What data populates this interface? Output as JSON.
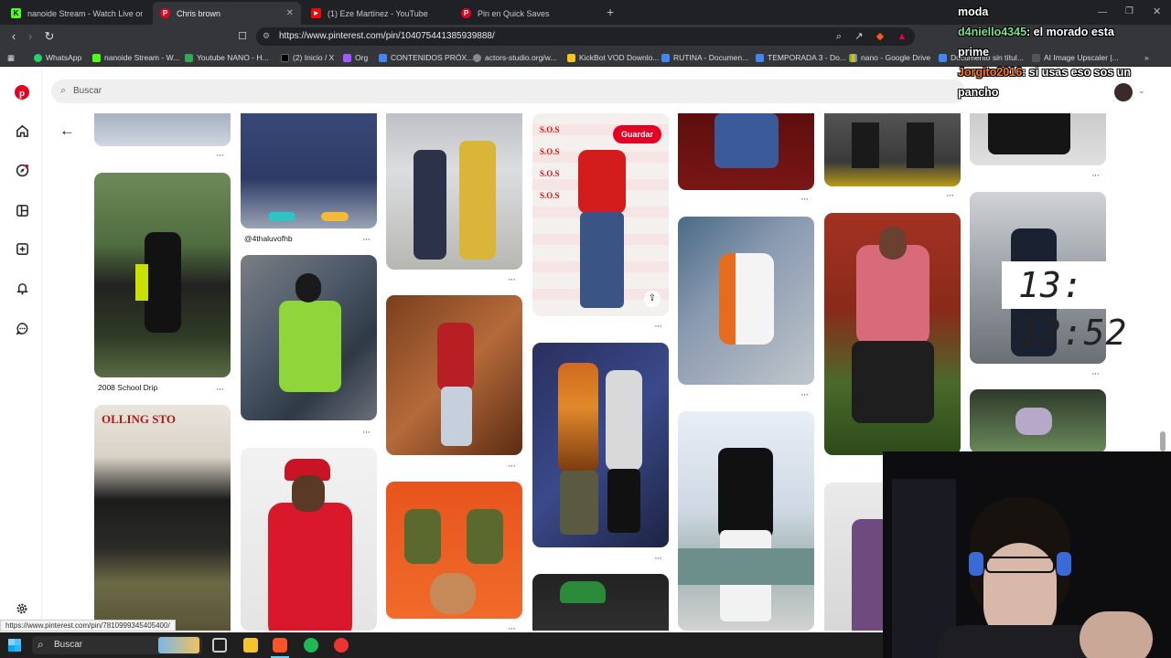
{
  "browser": {
    "tabs": [
      {
        "label": "nanoide Stream - Watch Live on Kick",
        "fav": "K",
        "color": "#53fc18"
      },
      {
        "label": "Chris brown",
        "fav": "P",
        "color": "#e60023"
      },
      {
        "label": "(1) Eze Martínez - YouTube",
        "fav": "▶",
        "color": "#ff0000"
      },
      {
        "label": "Pin en Quick Saves",
        "fav": "P",
        "color": "#e60023"
      }
    ],
    "url": "https://www.pinterest.com/pin/1040754413859398​88/",
    "bookmarks": [
      "WhatsApp",
      "nanoide Stream - W...",
      "Youtube NANO - H...",
      "(2) Inicio / X",
      "Org",
      "CONTENIDOS PRÓX...",
      "actors-studio.org/w...",
      "KickBot VOD Downlo...",
      "RUTINA - Documen...",
      "TEMPORADA 3 - Do...",
      "nano - Google Drive",
      "Documento sin títul...",
      "AI Image Upscaler |..."
    ]
  },
  "pinterest": {
    "search_placeholder": "Buscar",
    "save_label": "Guardar",
    "captions": [
      "@4thaluvofhb",
      "2008 School Drip"
    ],
    "status_url": "https://www.pinterest.com/pin/781099934540540​0/"
  },
  "taskbar": {
    "search_label": "Buscar"
  },
  "stream": {
    "chat": [
      {
        "user": "",
        "text": "moda"
      },
      {
        "user": "d4niello4345",
        "text": ": el morado esta"
      },
      {
        "user": "",
        "text": "prime"
      },
      {
        "user": "Jorgito2016",
        "text": ": si usas eso sos un"
      },
      {
        "user": "",
        "text": "pancho"
      }
    ],
    "clock": "13: 12:52"
  },
  "colors": {
    "brand": "#e60023",
    "chrome_dark": "#202124",
    "chrome_mid": "#35363a"
  }
}
